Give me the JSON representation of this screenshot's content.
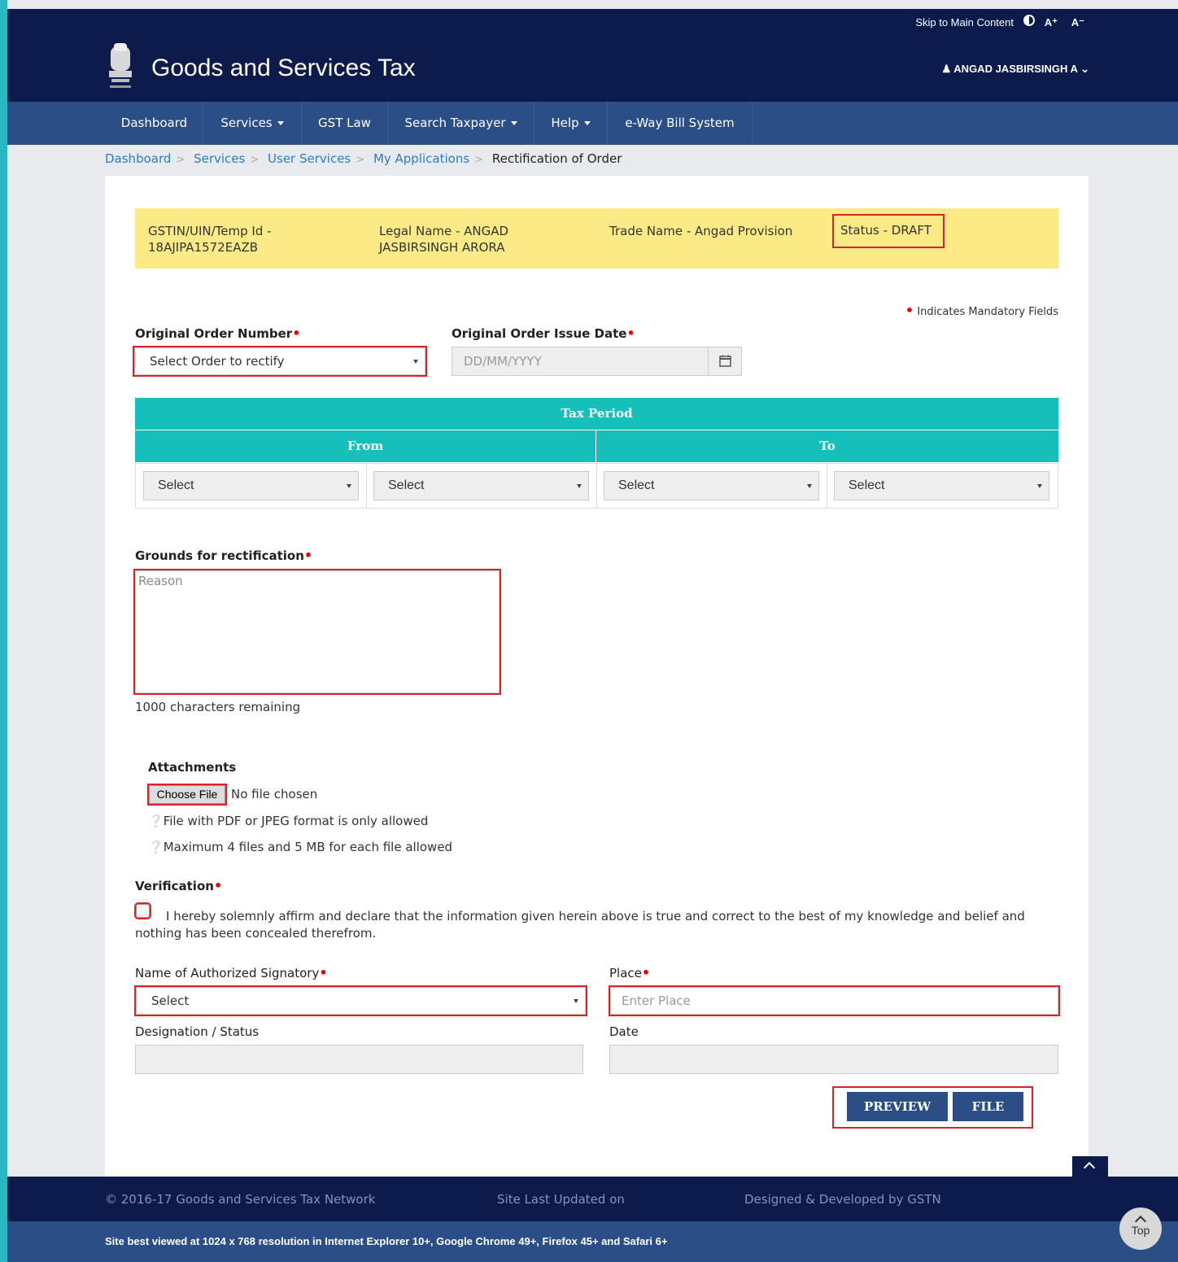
{
  "topbar": {
    "skip": "Skip to Main Content",
    "a_plus": "A⁺",
    "a_minus": "A⁻"
  },
  "header": {
    "title": "Goods and Services Tax",
    "user": "ANGAD JASBIRSINGH A"
  },
  "nav": {
    "items": [
      "Dashboard",
      "Services",
      "GST Law",
      "Search Taxpayer",
      "Help",
      "e-Way Bill System"
    ]
  },
  "breadcrumb": [
    "Dashboard",
    "Services",
    "User Services",
    "My Applications",
    "Rectification of Order"
  ],
  "taxpayer": {
    "gstin_line1": "GSTIN/UIN/Temp Id -",
    "gstin_line2": "18AJIPA1572EAZB",
    "legal_line1": "Legal Name - ANGAD",
    "legal_line2": "JASBIRSINGH ARORA",
    "trade": "Trade Name - Angad Provision",
    "status": "Status - DRAFT"
  },
  "form": {
    "mandatory_note": "Indicates Mandatory Fields",
    "order_number_label": "Original Order Number",
    "order_number_value": "Select Order to rectify",
    "issue_date_label": "Original Order Issue Date",
    "issue_date_placeholder": "DD/MM/YYYY",
    "tax_period_header": "Tax Period",
    "from_header": "From",
    "to_header": "To",
    "period_selects": [
      "Select",
      "Select",
      "Select",
      "Select"
    ],
    "grounds_label": "Grounds for rectification",
    "grounds_placeholder": "Reason",
    "chars_remaining": "1000 characters remaining",
    "attachments_label": "Attachments",
    "choose_file": "Choose File",
    "no_file": "No file chosen",
    "file_info1": "File with PDF or JPEG format is only allowed",
    "file_info2": "Maximum 4 files and 5 MB for each file allowed",
    "verification_label": "Verification",
    "declaration_line1": "I hereby solemnly affirm and declare that the information given herein above is true and correct to the best of my knowledge and belief and",
    "declaration_line2": "nothing has been concealed therefrom.",
    "signatory_label": "Name of Authorized Signatory",
    "signatory_value": "Select",
    "place_label": "Place",
    "place_placeholder": "Enter Place",
    "designation_label": "Designation / Status",
    "date_label": "Date",
    "preview_button": "PREVIEW",
    "file_button": "FILE"
  },
  "footer": {
    "copyright": "© 2016-17 Goods and Services Tax Network",
    "updated": "Site Last Updated on",
    "designed": "Designed & Developed by GSTN",
    "best_viewed": "Site best viewed at 1024 x 768 resolution in Internet Explorer 10+, Google Chrome 49+, Firefox 45+ and Safari 6+",
    "top_label": "Top"
  },
  "colors": {
    "navy": "#0c1a4c",
    "nav_blue": "#2c4e86",
    "teal": "#17bfba",
    "info_yellow": "#fbea86",
    "highlight_red": "#d8232a"
  }
}
